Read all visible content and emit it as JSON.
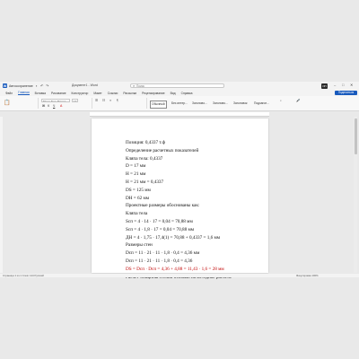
{
  "titlebar": {
    "autosave": "Автосохранение",
    "doc_title": "Документ1 - Word",
    "search_placeholder": "Поиск",
    "avatar": "ИП"
  },
  "menu": {
    "items": [
      "Файл",
      "Главная",
      "Вставка",
      "Рисование",
      "Конструктор",
      "Макет",
      "Ссылки",
      "Рассылки",
      "Рецензирование",
      "Вид",
      "Справка"
    ],
    "active": "Главная",
    "share": "Поделиться"
  },
  "ribbon": {
    "font_name": "Times New Roman",
    "font_size": "14",
    "styles": [
      "Обычный",
      "Без интер...",
      "Заголово...",
      "Заголово...",
      "Заголовок",
      "Подзагол..."
    ]
  },
  "document": {
    "lines": [
      "Позиция: 0,4337 т.ф",
      "Определение расчетных показателей",
      "Кляпа тела: 0,4337",
      "D = 17 мм",
      "Н = 21 мм",
      "Н = 21 мм = 0,4337",
      "DS = 125 мм",
      "DH = 62 мм",
      "Проектные размеры обоснованы как:",
      "Кляпа тела",
      "Sсп = 4 · 14 · 17 = 0,04 = 70,88 мм",
      "Sсп = 4 · 1,8 · 17 = 0,04 = 70,88 мм",
      "ДН = 4 · 1,75 · 17,4(1) = 70,88 + 0,4337 = 1,6 мм",
      "Размеры стен",
      "Dсп = 11 · 21 · 11 · 1,8 · 0,4 = 4,36 мм",
      "Dсп = 11 · 21 · 11 · 1,8 · 0,4 = 4,36",
      "DS = Dсп · Dсп = 4,36 + 4,88 = 11,43 · 1,6 = 28 мм",
      "Расчет толщины стенки основан на методике расчета"
    ],
    "red_line_index": 16
  },
  "status": {
    "left": "Страница 1 из 1   Слов: 124   Русский",
    "right": "Фокусировка   100%"
  }
}
